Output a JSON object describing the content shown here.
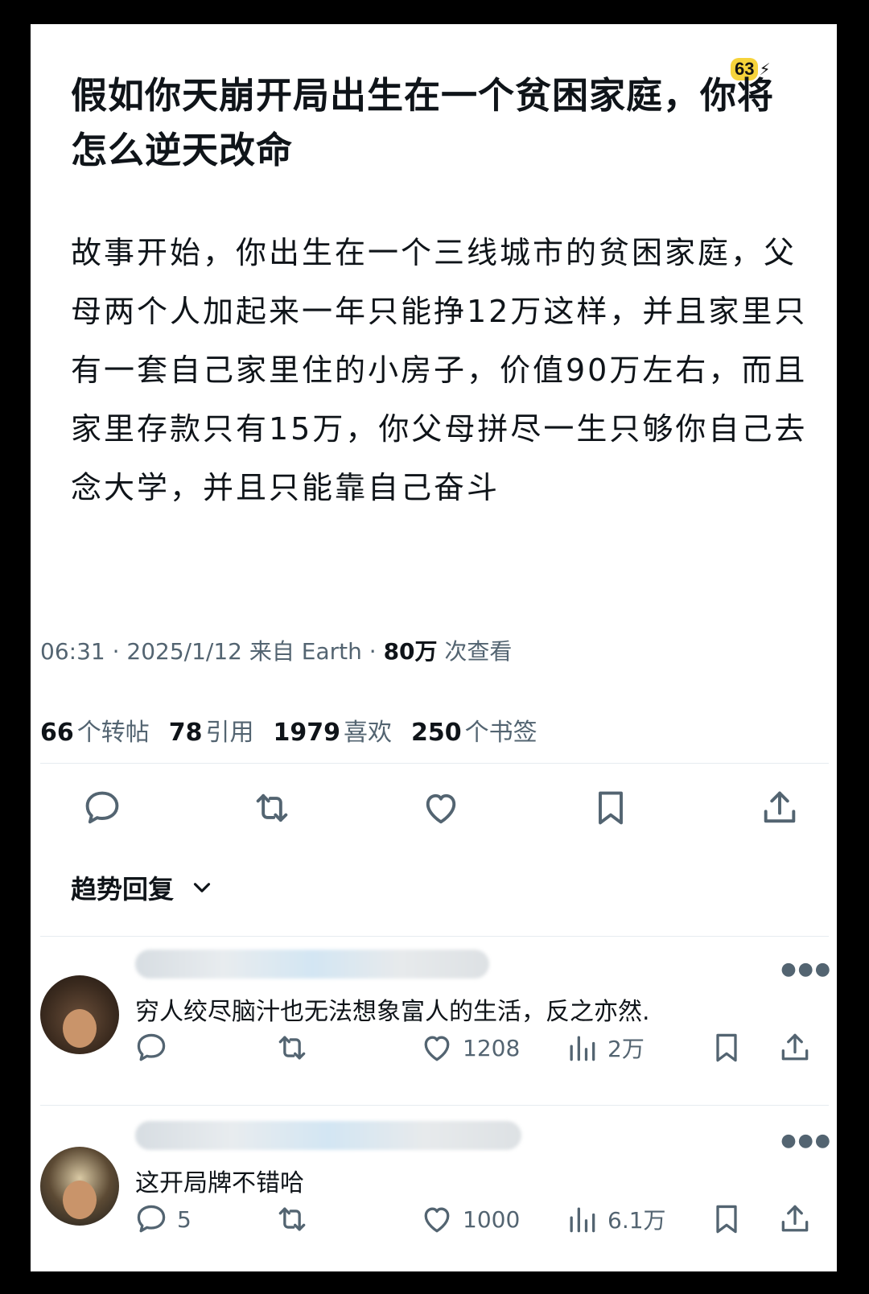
{
  "badge": {
    "count": "63",
    "bolt": "⚡"
  },
  "post": {
    "title": "假如你天崩开局出生在一个贫困家庭，你将怎么逆天改命",
    "body": "故事开始，你出生在一个三线城市的贫困家庭，父母两个人加起来一年只能挣12万这样，并且家里只有一套自己家里住的小房子，价值90万左右，而且家里存款只有15万，你父母拼尽一生只够你自己去念大学，并且只能靠自己奋斗",
    "meta_prefix": "06:31 · 2025/1/12 来自 Earth · ",
    "views_count": "80万",
    "views_label": " 次查看"
  },
  "stats": [
    {
      "num": "66",
      "label": "个转帖"
    },
    {
      "num": "78",
      "label": "引用"
    },
    {
      "num": "1979",
      "label": "喜欢"
    },
    {
      "num": "250",
      "label": "个书签"
    }
  ],
  "actions": {
    "icons": [
      "reply-icon",
      "retweet-icon",
      "like-icon",
      "bookmark-icon",
      "share-icon"
    ]
  },
  "replies_section": {
    "label": "趋势回复"
  },
  "replies": [
    {
      "text": "穷人绞尽脑汁也无法想象富人的生活，反之亦然.",
      "reply_count": "",
      "likes": "1208",
      "views": "2万"
    },
    {
      "text": "这开局牌不错哈",
      "reply_count": "5",
      "likes": "1000",
      "views": "6.1万"
    }
  ],
  "colors": {
    "text": "#0f1419",
    "muted": "#536471",
    "badge": "#f6d33b"
  }
}
